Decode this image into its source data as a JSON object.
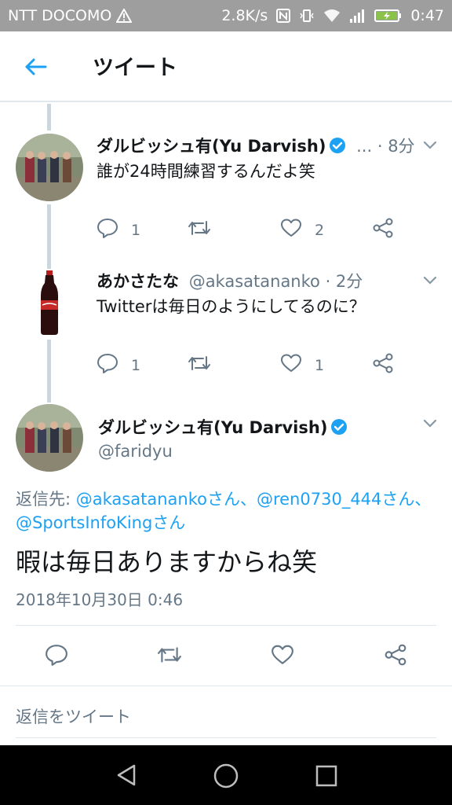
{
  "status": {
    "carrier": "NTT DOCOMO",
    "speed": "2.8K/s",
    "time": "0:47"
  },
  "header": {
    "title": "ツイート"
  },
  "tweets": [
    {
      "name": "ダルビッシュ有(Yu Darvish)",
      "handle": "...",
      "time": "· 8分",
      "text": "誰が24時間練習するんだよ笑",
      "reply_count": "1",
      "like_count": "2"
    },
    {
      "name": "あかさたな",
      "handle": "@akasatananko",
      "time": "· 2分",
      "text": "Twitterは毎日のようにしてるのに？",
      "reply_count": "1",
      "like_count": "1"
    }
  ],
  "main": {
    "name": "ダルビッシュ有(Yu Darvish)",
    "handle": "@faridyu",
    "reply_prefix": "返信先: ",
    "reply_links": [
      "@akasatanankoさん",
      "@ren0730_444さん",
      "@SportsInfoKingさん"
    ],
    "reply_sep": "、",
    "text": "暇は毎日ありますからね笑",
    "timestamp": "2018年10月30日 0:46"
  },
  "compose": {
    "placeholder": "返信をツイート"
  },
  "colors": {
    "accent": "#1da1f2",
    "secondary_text": "#657786",
    "statusbar": "#9e9e9e"
  }
}
